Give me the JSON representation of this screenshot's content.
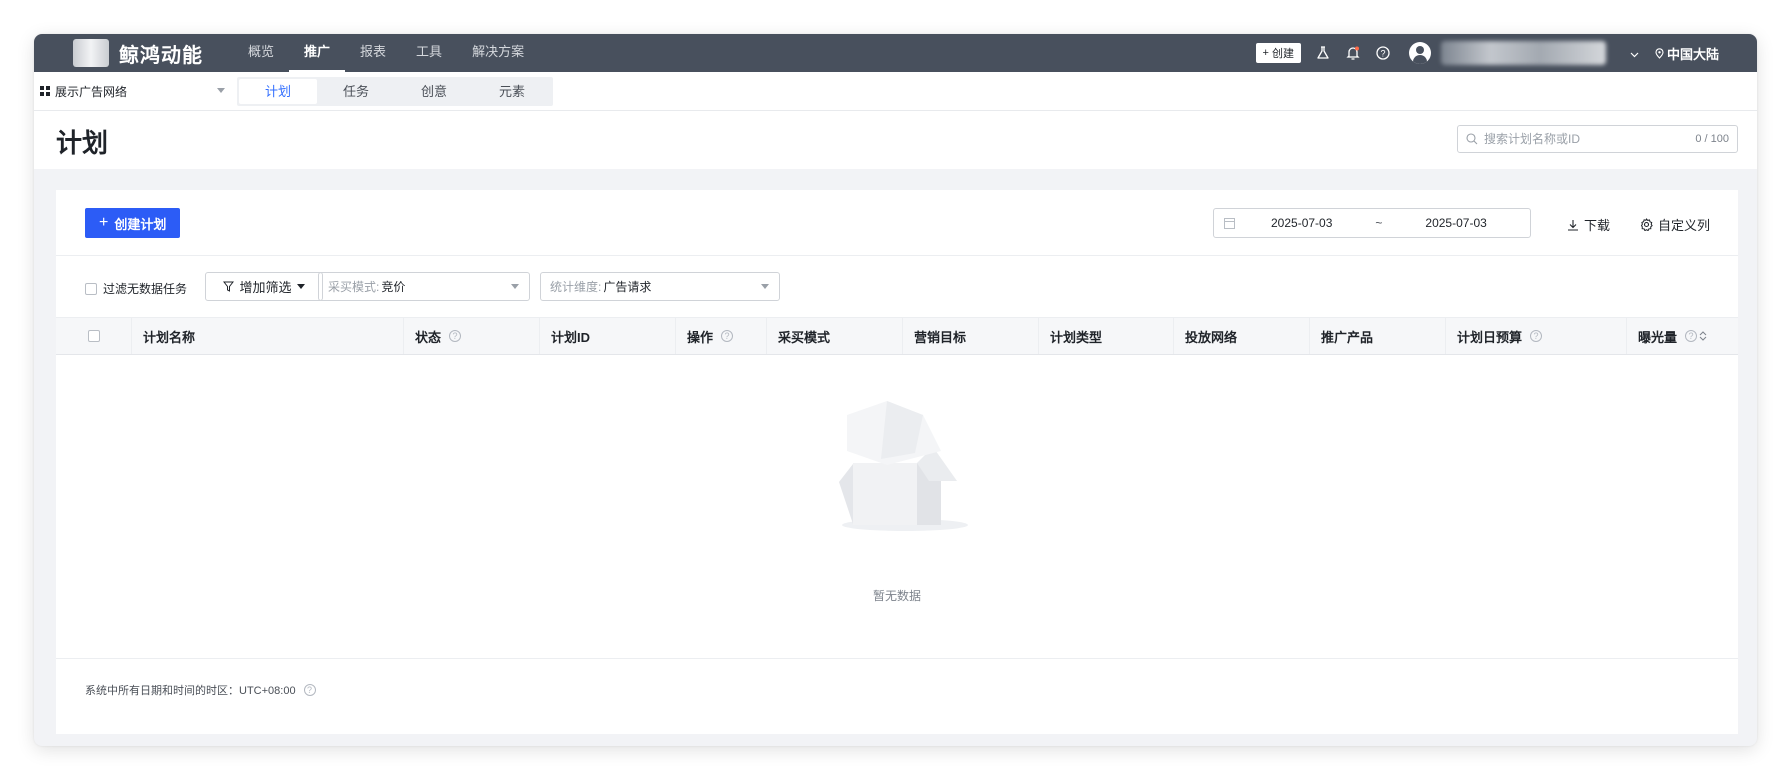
{
  "app": {
    "brand": "鲸鸿动能",
    "nav": [
      "概览",
      "推广",
      "报表",
      "工具",
      "解决方案"
    ],
    "nav_active_index": 1,
    "create_label": "创建",
    "region": "中国大陆"
  },
  "subbar": {
    "network": "展示广告网络",
    "tabs": [
      "计划",
      "任务",
      "创意",
      "元素"
    ],
    "active_tab_index": 0
  },
  "page": {
    "title": "计划",
    "search_placeholder": "搜索计划名称或ID",
    "search_count": "0 / 100"
  },
  "toolbar": {
    "create_plan": "创建计划",
    "date_start": "2025-07-03",
    "date_sep": "~",
    "date_end": "2025-07-03",
    "download": "下载",
    "custom_columns": "自定义列"
  },
  "filters": {
    "filter_no_data": "过滤无数据任务",
    "add_filter": "增加筛选",
    "purchase_mode_label": "采买模式:",
    "purchase_mode_value": "竞价",
    "stat_dim_label": "统计维度:",
    "stat_dim_value": "广告请求"
  },
  "table": {
    "columns": [
      "计划名称",
      "状态",
      "计划ID",
      "操作",
      "采买模式",
      "营销目标",
      "计划类型",
      "投放网络",
      "推广产品",
      "计划日预算",
      "曝光量"
    ],
    "empty_text": "暂无数据"
  },
  "footer": {
    "timezone_note": "系统中所有日期和时间的时区：UTC+08:00"
  },
  "colors": {
    "topbar": "#48505d",
    "primary": "#2c5cf6",
    "active_tab": "#3470ff",
    "page_bg": "#f2f3f6"
  }
}
